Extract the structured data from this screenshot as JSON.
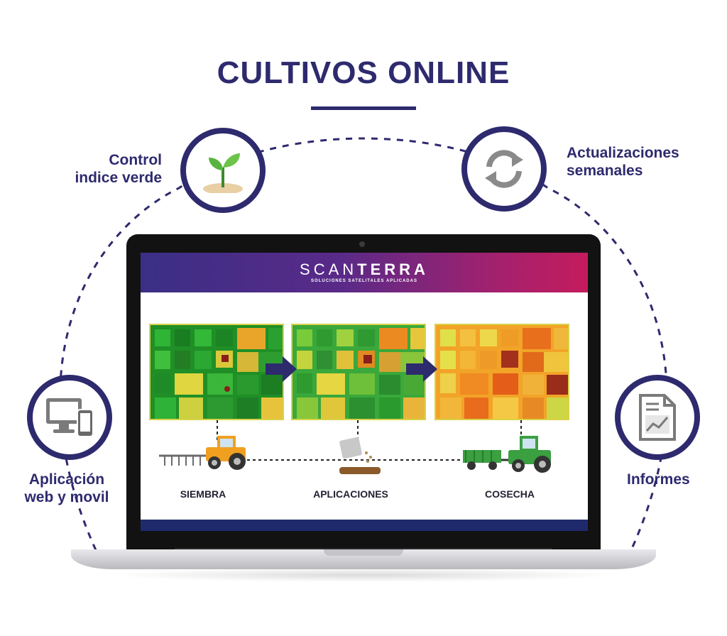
{
  "header": {
    "title": "CULTIVOS ONLINE"
  },
  "features": {
    "control": {
      "line1": "Control",
      "line2": "indice verde",
      "icon": "sprout-icon"
    },
    "updates": {
      "line1": "Actualizaciones",
      "line2": "semanales",
      "icon": "refresh-icon"
    },
    "app": {
      "line1": "Aplicación",
      "line2": "web y movil",
      "icon": "devices-icon"
    },
    "reports": {
      "line1": "Informes",
      "icon": "report-icon"
    }
  },
  "screen": {
    "brand_light": "SCAN",
    "brand_bold": "TERRA",
    "brand_tagline": "SOLUCIONES SATELITALES APLICADAS",
    "stages": {
      "siembra": "SIEMBRA",
      "aplicaciones": "APLICACIONES",
      "cosecha": "COSECHA"
    }
  },
  "colors": {
    "navy": "#2e2a6e",
    "header_start": "#3a2f86",
    "header_end": "#c41c5d",
    "footer": "#1f2a6d",
    "tractor_orange": "#f0a020",
    "tractor_green": "#3aa040"
  }
}
